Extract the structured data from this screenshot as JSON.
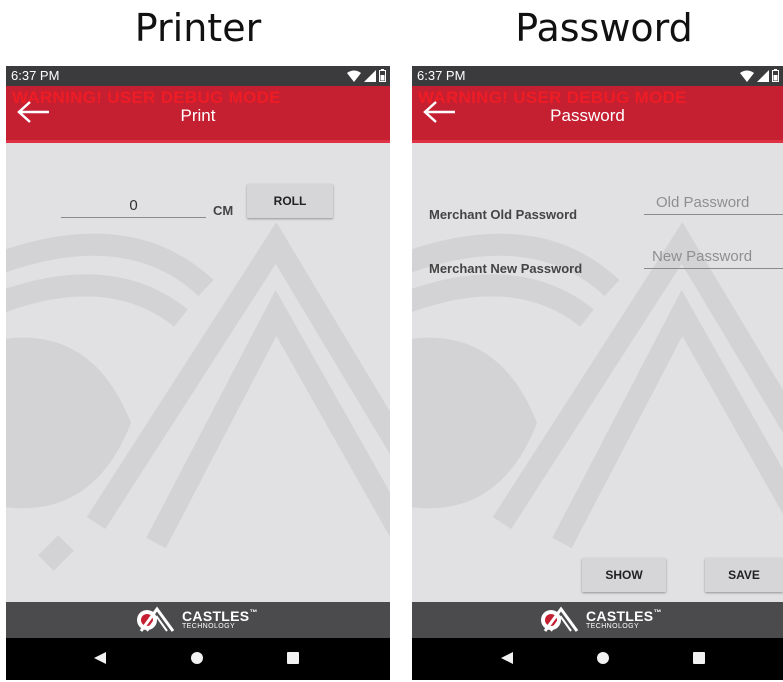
{
  "captions": {
    "left": "Printer",
    "right": "Password"
  },
  "status": {
    "time": "6:37 PM"
  },
  "warning_text": "WARNING! USER DEBUG MODE",
  "printer": {
    "title": "Print",
    "length_value": "0",
    "unit_label": "CM",
    "roll_label": "ROLL"
  },
  "password": {
    "title": "Password",
    "old_label": "Merchant Old Password",
    "old_placeholder": "Old Password",
    "new_label": "Merchant New Password",
    "new_placeholder": "New Password",
    "show_label": "SHOW",
    "save_label": "SAVE"
  },
  "footer": {
    "brand": "CASTLES",
    "tm": "™",
    "brand_sub": "TECHNOLOGY"
  },
  "colors": {
    "appbar": "#c42032",
    "warning": "#ee1c24",
    "footer": "#4b4b4d",
    "content_bg": "#e1e1e3"
  },
  "icons": {
    "back": "arrow-left-icon",
    "nav_back": "triangle-back-icon",
    "nav_home": "circle-home-icon",
    "nav_recents": "square-recents-icon"
  }
}
